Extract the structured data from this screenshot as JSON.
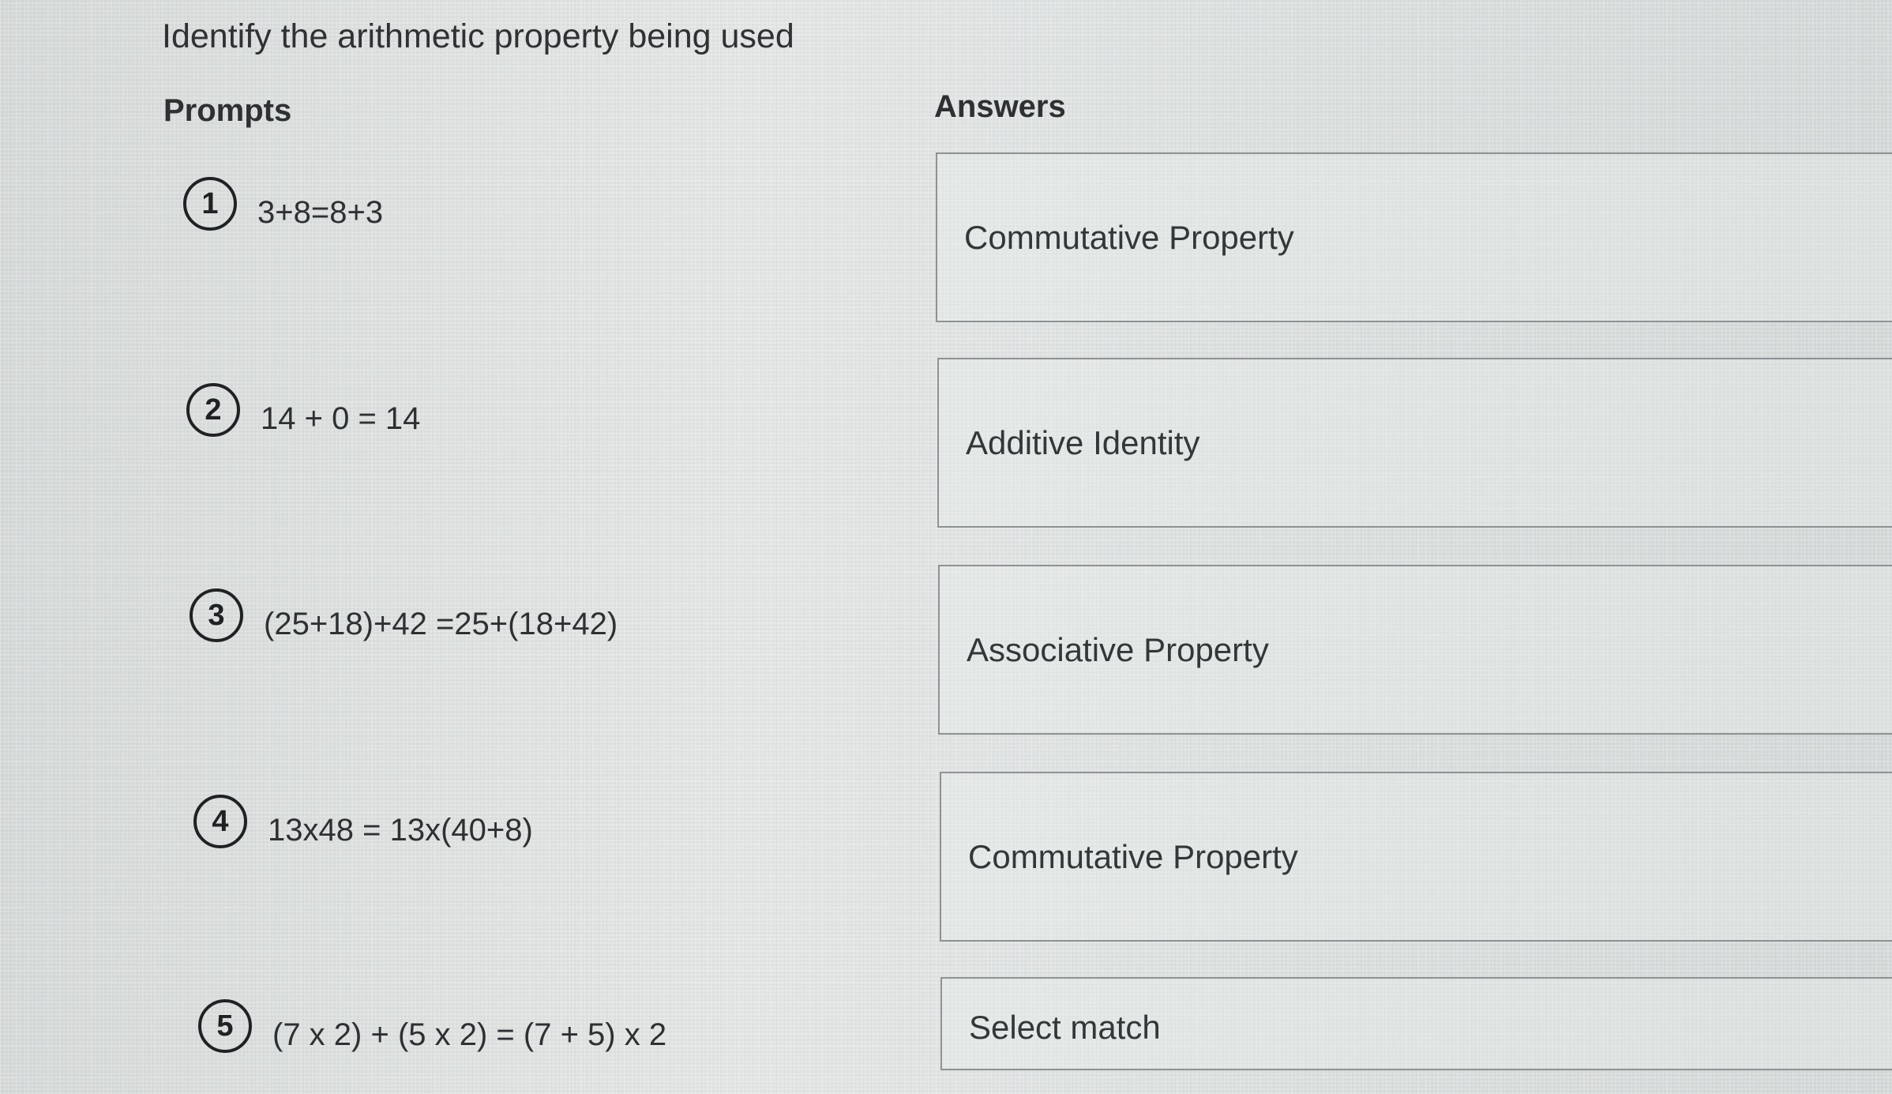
{
  "question": {
    "instructions": "Identify the arithmetic property being used"
  },
  "prompts": {
    "heading": "Prompts",
    "items": [
      {
        "number": "1",
        "text": "3+8=8+3"
      },
      {
        "number": "2",
        "text": "14 + 0 = 14"
      },
      {
        "number": "3",
        "text": "(25+18)+42 =25+(18+42)"
      },
      {
        "number": "4",
        "text": "13x48 = 13x(40+8)"
      },
      {
        "number": "5",
        "text": "(7 x 2) + (5 x 2) = (7 + 5) x 2"
      }
    ]
  },
  "answers": {
    "heading": "Answers",
    "items": [
      {
        "label": "Commutative Property"
      },
      {
        "label": "Additive Identity"
      },
      {
        "label": "Associative Property"
      },
      {
        "label": "Commutative Property"
      },
      {
        "label": "Select match"
      }
    ]
  }
}
